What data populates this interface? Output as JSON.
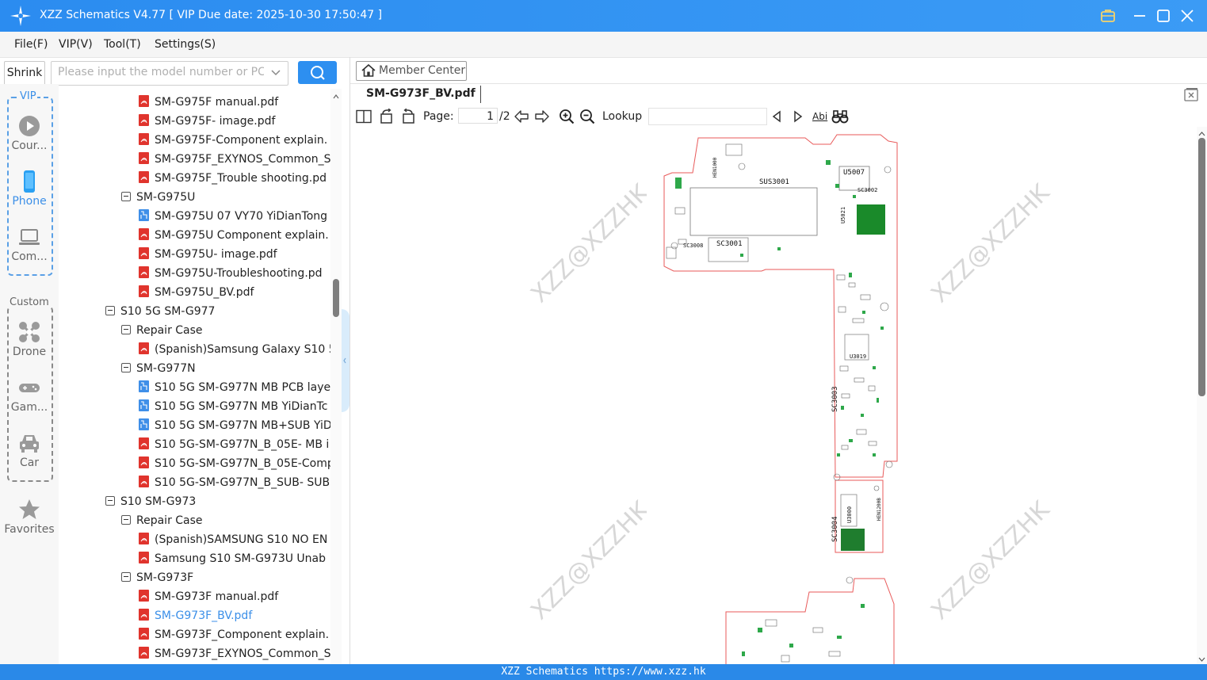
{
  "app": {
    "title": "XZZ Schematics V4.77 [ VIP Due date: 2025-10-30 17:50:47 ]",
    "accent": "#2d8ff0"
  },
  "menu": [
    "File(F)",
    "VIP(V)",
    "Tool(T)",
    "Settings(S)"
  ],
  "search": {
    "shrink_label": "Shrink",
    "placeholder": "Please input the model number or PCB"
  },
  "rail": {
    "vip_group_label": "VIP",
    "custom_group_label": "Custom",
    "items": [
      {
        "label": "Cour...",
        "icon": "play-icon"
      },
      {
        "label": "Phone",
        "icon": "phone-icon"
      },
      {
        "label": "Com...",
        "icon": "laptop-icon"
      },
      {
        "label": "Drone",
        "icon": "drone-icon"
      },
      {
        "label": "Gam...",
        "icon": "gamepad-icon"
      },
      {
        "label": "Car",
        "icon": "car-icon"
      },
      {
        "label": "Favorites",
        "icon": "star-icon"
      }
    ]
  },
  "tree": [
    {
      "label": "SM-G975F manual.pdf",
      "level": 2,
      "kind": "pdf"
    },
    {
      "label": "SM-G975F- image.pdf",
      "level": 2,
      "kind": "pdf"
    },
    {
      "label": "SM-G975F-Component explain.",
      "level": 2,
      "kind": "pdf"
    },
    {
      "label": "SM-G975F_EXYNOS_Common_S",
      "level": 2,
      "kind": "pdf"
    },
    {
      "label": "SM-G975F_Trouble shooting.pd",
      "level": 2,
      "kind": "pdf"
    },
    {
      "label": "SM-G975U",
      "level": 1,
      "kind": "folder"
    },
    {
      "label": "SM-G975U 07 VY70 YiDianTong",
      "level": 2,
      "kind": "pcb"
    },
    {
      "label": "SM-G975U Component explain.",
      "level": 2,
      "kind": "pdf"
    },
    {
      "label": "SM-G975U- image.pdf",
      "level": 2,
      "kind": "pdf"
    },
    {
      "label": "SM-G975U-Troubleshooting.pd",
      "level": 2,
      "kind": "pdf"
    },
    {
      "label": "SM-G975U_BV.pdf",
      "level": 2,
      "kind": "pdf"
    },
    {
      "label": "S10 5G SM-G977",
      "level": 0,
      "kind": "folder"
    },
    {
      "label": "Repair Case",
      "level": 1,
      "kind": "folder"
    },
    {
      "label": "(Spanish)Samsung Galaxy S10 5",
      "level": 2,
      "kind": "pdf"
    },
    {
      "label": "SM-G977N",
      "level": 1,
      "kind": "folder"
    },
    {
      "label": "S10 5G SM-G977N MB PCB laye",
      "level": 2,
      "kind": "pcb"
    },
    {
      "label": "S10 5G SM-G977N MB YiDianTc",
      "level": 2,
      "kind": "pcb"
    },
    {
      "label": "S10 5G SM-G977N MB+SUB YiD",
      "level": 2,
      "kind": "pcb"
    },
    {
      "label": "S10 5G-SM-G977N_B_05E- MB i",
      "level": 2,
      "kind": "pdf"
    },
    {
      "label": "S10 5G-SM-G977N_B_05E-Comp",
      "level": 2,
      "kind": "pdf"
    },
    {
      "label": "S10 5G-SM-G977N_B_SUB- SUB",
      "level": 2,
      "kind": "pdf"
    },
    {
      "label": "S10 SM-G973",
      "level": 0,
      "kind": "folder"
    },
    {
      "label": "Repair Case",
      "level": 1,
      "kind": "folder"
    },
    {
      "label": "(Spanish)SAMSUNG S10 NO EN",
      "level": 2,
      "kind": "pdf"
    },
    {
      "label": "Samsung S10 SM-G973U  Unab",
      "level": 2,
      "kind": "pdf"
    },
    {
      "label": "SM-G973F",
      "level": 1,
      "kind": "folder"
    },
    {
      "label": "SM-G973F manual.pdf",
      "level": 2,
      "kind": "pdf"
    },
    {
      "label": "SM-G973F_BV.pdf",
      "level": 2,
      "kind": "pdf",
      "selected": true
    },
    {
      "label": "SM-G973F_Component explain.",
      "level": 2,
      "kind": "pdf"
    },
    {
      "label": "SM-G973F_EXYNOS_Common_S",
      "level": 2,
      "kind": "pdf"
    }
  ],
  "viewer": {
    "member_center": "Member Center",
    "tab_title": "SM-G973F_BV.pdf",
    "page_label": "Page:",
    "page_value": "1",
    "page_total": "/2",
    "lookup_label": "Lookup",
    "find_abi": "Abi",
    "watermark": "XZZ@XZZHK",
    "board_labels": [
      "SUS3001",
      "U5007",
      "SC3002",
      "U5021",
      "SC3008",
      "SC3001",
      "SC3003",
      "U3019",
      "U3000",
      "SC3004",
      "HEN1200B",
      "HEN1000"
    ]
  },
  "status": "XZZ Schematics https://www.xzz.hk"
}
